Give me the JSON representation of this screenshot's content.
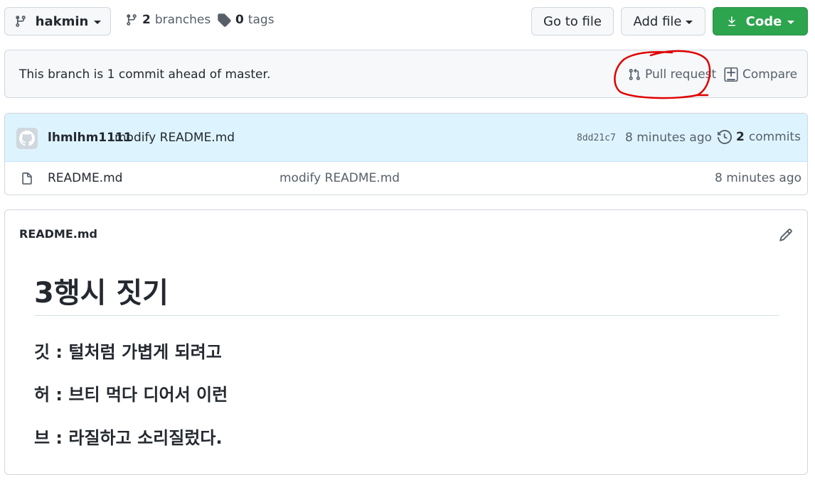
{
  "branch_selector": {
    "label": "hakmin"
  },
  "branches": {
    "count": "2",
    "label": "branches"
  },
  "tags": {
    "count": "0",
    "label": "tags"
  },
  "buttons": {
    "go_to_file": "Go to file",
    "add_file": "Add file",
    "code": "Code"
  },
  "branch_status": {
    "text": "This branch is 1 commit ahead of master.",
    "pull_request": "Pull request",
    "compare": "Compare"
  },
  "latest_commit": {
    "author": "lhmlhm1111",
    "message": "modify README.md",
    "sha": "8dd21c7",
    "time": "8 minutes ago",
    "commits_count": "2",
    "commits_label": "commits"
  },
  "files": [
    {
      "name": "README.md",
      "message": "modify README.md",
      "time": "8 minutes ago"
    }
  ],
  "readme": {
    "filename": "README.md",
    "heading": "3행시 짓기",
    "lines": [
      "깃 : 털처럼 가볍게 되려고",
      "허 : 브티 먹다 디어서 이런",
      "브 : 라질하고 소리질렀다."
    ]
  },
  "colors": {
    "accent_green": "#2da44e",
    "annotation_red": "#e00000",
    "commit_bar": "#ddf4ff"
  }
}
